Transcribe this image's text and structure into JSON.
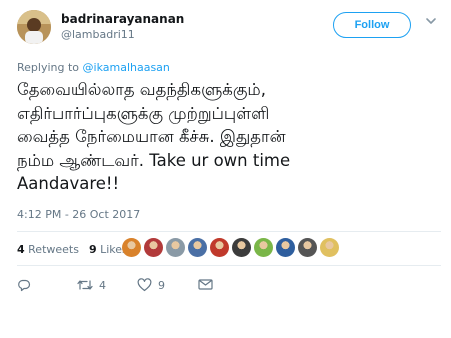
{
  "user": {
    "name": "badrinarayananan",
    "handle": "@lambadri11"
  },
  "follow_label": "Follow",
  "reply_to": {
    "prefix": "Replying to ",
    "handle": "@ikamalhaasan"
  },
  "tweet_lines": [
    "தேவையில்லாத வதந்திகளுக்கும்,",
    "எதிர்பார்ப்புகளுக்கு முற்றுப்புள்ளி",
    "வைத்த நேர்மையான கீச்சு. இதுதான்",
    "நம்ம ஆண்டவர். Take ur own time",
    "Aandavare!!"
  ],
  "timestamp": "4:12 PM - 26 Oct 2017",
  "stats": {
    "retweets_count": "4",
    "retweets_label": "Retweets",
    "likes_count": "9",
    "likes_label": "Likes"
  },
  "liker_avatar_colors": [
    "#d9822b",
    "#b23a3a",
    "#8a9aa6",
    "#4a6fa5",
    "#c0392b",
    "#3c3c3c",
    "#7ab648",
    "#2e5e9e",
    "#555555",
    "#e0c060"
  ],
  "actions": {
    "reply_icon": "reply-icon",
    "retweet_icon": "retweet-icon",
    "retweet_count": "4",
    "like_icon": "heart-icon",
    "like_count": "9",
    "dm_icon": "envelope-icon"
  },
  "colors": {
    "accent": "#1da1f2",
    "text": "#14171a",
    "muted": "#657786",
    "divider": "#e6ecf0"
  }
}
